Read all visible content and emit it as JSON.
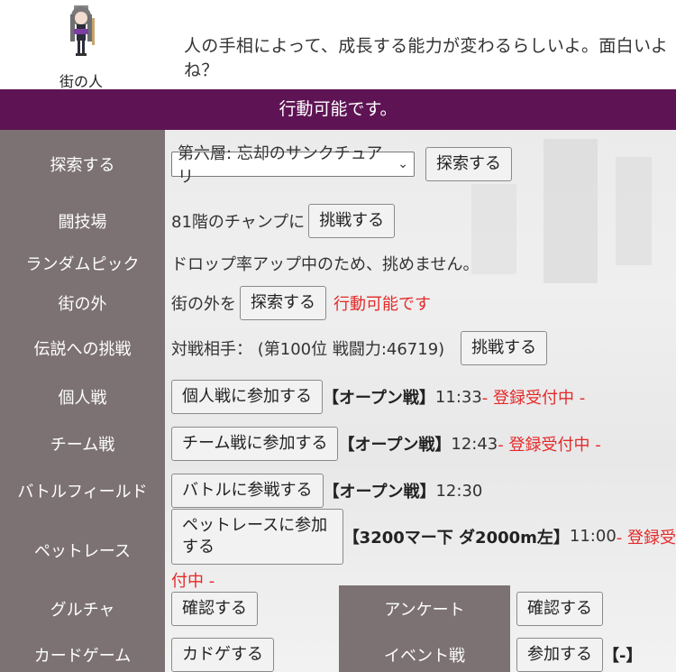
{
  "header": {
    "npc_name": "街の人",
    "speech": "人の手相によって、成長する能力が変わるらしいよ。面白いよね？"
  },
  "banner": "行動可能です。",
  "explore": {
    "label": "探索する",
    "select_value": "第六層: 忘却のサンクチュアリ",
    "button": "探索する"
  },
  "arena": {
    "label": "闘技場",
    "text": "81階のチャンプに",
    "button": "挑戦する"
  },
  "random_pick": {
    "label": "ランダムピック",
    "text": "ドロップ率アップ中のため、挑めません。"
  },
  "outside": {
    "label": "街の外",
    "text": "街の外を",
    "button": "探索する",
    "status": "行動可能です"
  },
  "legend": {
    "label": "伝説への挑戦",
    "text": "対戦相手： (第100位 戦闘力:46719)",
    "button": "挑戦する"
  },
  "solo": {
    "label": "個人戦",
    "button": "個人戦に参加する",
    "tag": "【オープン戦】",
    "time": "11:33",
    "status": " - 登録受付中 -"
  },
  "team": {
    "label": "チーム戦",
    "button": "チーム戦に参加する",
    "tag": "【オープン戦】",
    "time": "12:43",
    "status": " - 登録受付中 -"
  },
  "battlefield": {
    "label": "バトルフィールド",
    "button": "バトルに参戦する",
    "tag": "【オープン戦】",
    "time": "12:30"
  },
  "pet_race": {
    "label": "ペットレース",
    "button": "ペットレースに参加する",
    "tag": "【3200マー下 ダ2000m左】",
    "time": "11:00",
    "status_line1": " - 登録受",
    "status_line2": "付中 -"
  },
  "gacha": {
    "label": "グルチャ",
    "button": "確認する"
  },
  "survey": {
    "label": "アンケート",
    "button": "確認する"
  },
  "card_game": {
    "label": "カードゲーム",
    "button": "カドゲする"
  },
  "event_battle": {
    "label": "イベント戦",
    "button": "参加する",
    "tag": "【-】"
  },
  "colors": {
    "banner": "#5e1454",
    "label_bg": "#7c7273",
    "alert_red": "#e42a2a"
  }
}
